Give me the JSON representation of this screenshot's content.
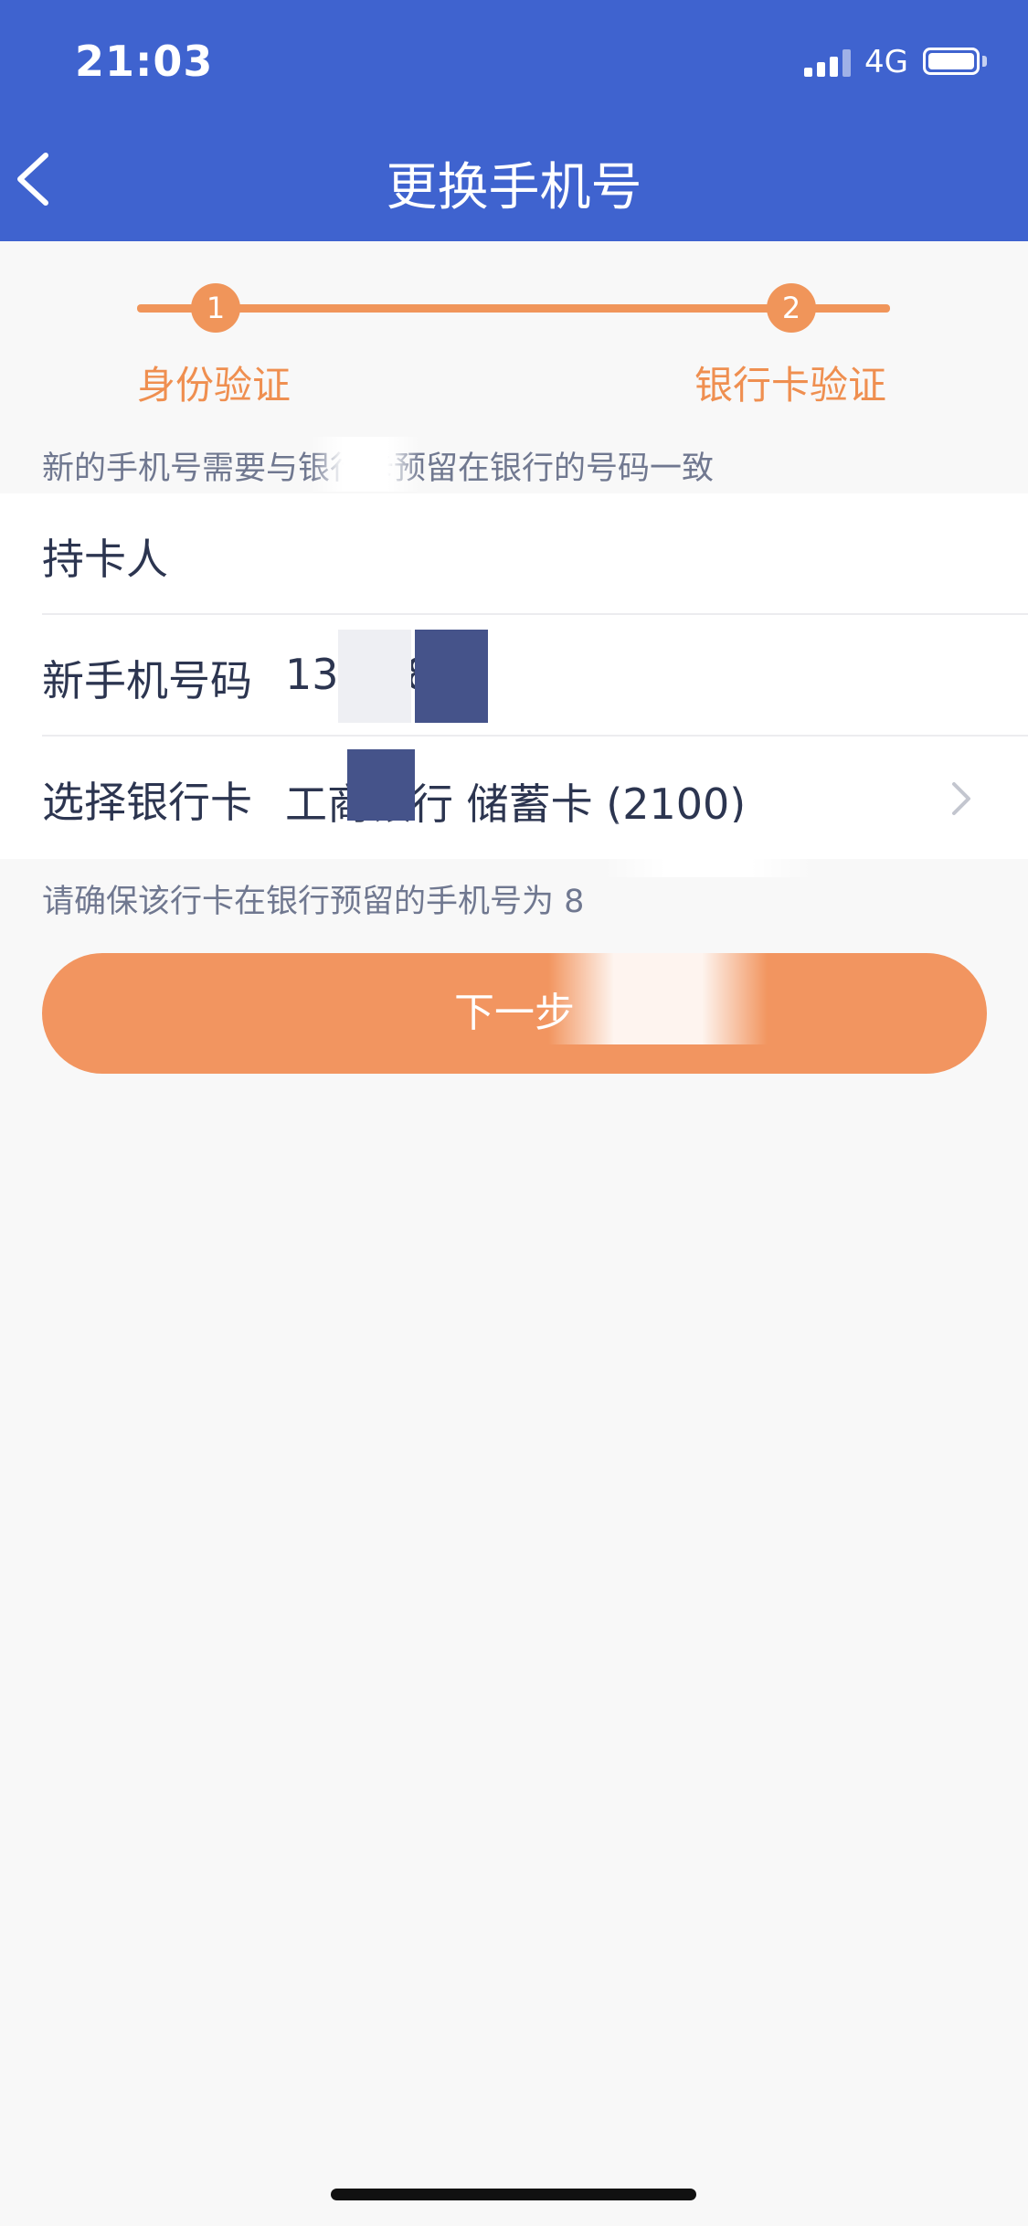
{
  "status": {
    "time": "21:03",
    "network": "4G"
  },
  "header": {
    "title": "更换手机号"
  },
  "steps": [
    {
      "number": "1",
      "label": "身份验证"
    },
    {
      "number": "2",
      "label": "银行卡验证"
    }
  ],
  "note_top": "新的手机号需要与银行卡预留在银行的号码一致",
  "form": {
    "holder_label": "持卡人",
    "holder_value": "",
    "phone_label": "新手机号码",
    "phone_value": "13      878",
    "card_label": "选择银行卡",
    "card_value": "工商银行 储蓄卡 (2100)"
  },
  "note_bottom": "请确保该行卡在银行预留的手机号为          8",
  "next_button_label": "下一步",
  "colors": {
    "header": "#3f63cf",
    "accent": "#f0955a",
    "button": "#f29560"
  }
}
